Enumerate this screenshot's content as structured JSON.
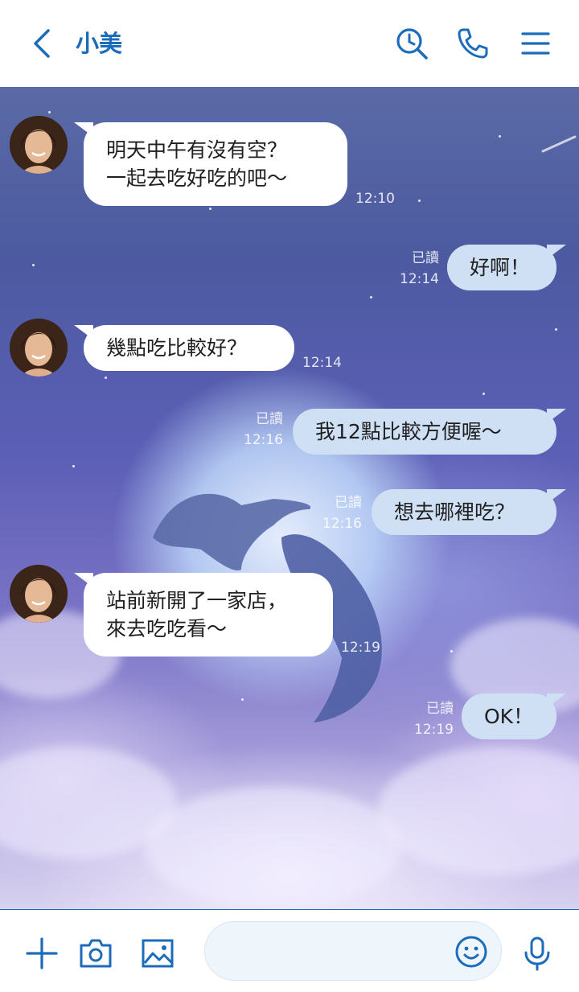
{
  "header": {
    "title": "小美",
    "icons": [
      "back-chevron-icon",
      "search-clock-icon",
      "phone-icon",
      "menu-icon"
    ]
  },
  "colors": {
    "accent": "#1b6dbb",
    "incoming_bubble": "#ffffff",
    "outgoing_bubble": "#cfe0f4"
  },
  "messages": [
    {
      "side": "in",
      "lines": [
        "明天中午有沒有空？",
        "一起去吃好吃的吧～"
      ],
      "time": "12:10"
    },
    {
      "side": "out",
      "text": "好啊！",
      "read": "已讀",
      "time": "12:14"
    },
    {
      "side": "in",
      "text": "幾點吃比較好？",
      "time": "12:14"
    },
    {
      "side": "out",
      "text": "我12點比較方便喔～",
      "read": "已讀",
      "time": "12:16"
    },
    {
      "side": "out",
      "text": "想去哪裡吃？",
      "read": "已讀",
      "time": "12:16"
    },
    {
      "side": "in",
      "lines": [
        "站前新開了一家店，",
        "來去吃吃看～"
      ],
      "time": "12:19"
    },
    {
      "side": "out",
      "text": "OK！",
      "read": "已讀",
      "time": "12:19"
    }
  ],
  "footer": {
    "input_placeholder": "",
    "icons": [
      "plus-icon",
      "camera-icon",
      "image-icon",
      "emoji-icon",
      "microphone-icon"
    ]
  }
}
